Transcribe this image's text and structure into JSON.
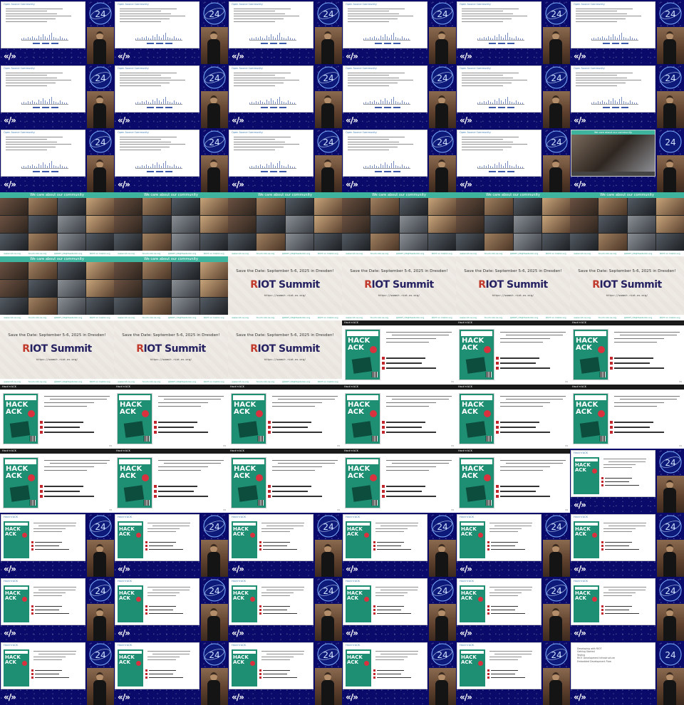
{
  "grid": {
    "columns": 6,
    "rows": 11
  },
  "frames": [
    "talk",
    "talk",
    "talk",
    "talk",
    "talk",
    "talk",
    "talk",
    "talk",
    "talk",
    "talk",
    "talk",
    "talk",
    "talk",
    "talk",
    "talk",
    "talk",
    "talk",
    "community-in-talk",
    "community",
    "community",
    "community",
    "community",
    "community",
    "community",
    "community",
    "community",
    "summit",
    "summit",
    "summit",
    "summit",
    "summit",
    "summit",
    "summit",
    "hack",
    "hack",
    "hack",
    "hack",
    "hack",
    "hack",
    "hack",
    "hack",
    "hack",
    "hack",
    "hack",
    "hack",
    "hack",
    "hack",
    "hack-in-talk",
    "hack-in-talk",
    "hack-in-talk",
    "hack-in-talk",
    "hack-in-talk",
    "hack-in-talk",
    "hack-in-talk",
    "hack-in-talk",
    "hack-in-talk",
    "hack-in-talk",
    "hack-in-talk",
    "hack-in-talk",
    "hack-in-talk",
    "hack-in-talk",
    "hack-in-talk",
    "hack-in-talk",
    "hack-in-talk",
    "hack-in-talk",
    "list-in-talk"
  ],
  "talk": {
    "slide_header": "Open Source Community",
    "brand_logo": "«/»"
  },
  "community": {
    "title": "We care about our community",
    "footer": [
      "www.riot-os.org",
      "forum.riot-os.org",
      "@RIOT_OS@fosstodon.org",
      "RIOT on matrix.org"
    ]
  },
  "summit": {
    "save": "Save the Date: September 5-6, 2025 in Dresden!",
    "mark_r": "R",
    "mark_rest": "IOT Summit",
    "url": "https://summit.riot-os.org/",
    "footer": [
      "www.riot-os.org",
      "forum.riot-os.org",
      "@RIOT_OS@fosstodon.org",
      "RIOT on matrix.org"
    ]
  },
  "hack": {
    "header": "Hack'n'ACK",
    "poster_title": "HACK\nACK",
    "page_num": "31"
  },
  "list": {
    "items": [
      "Developing with RIOT",
      "Getting Started",
      "Testing",
      "RIOT Development Infrastructure",
      "Embedded Development Flow"
    ]
  },
  "colors": {
    "teal": "#3eb39d",
    "navy": "#0a0a6a",
    "riot_red": "#c0392b"
  }
}
